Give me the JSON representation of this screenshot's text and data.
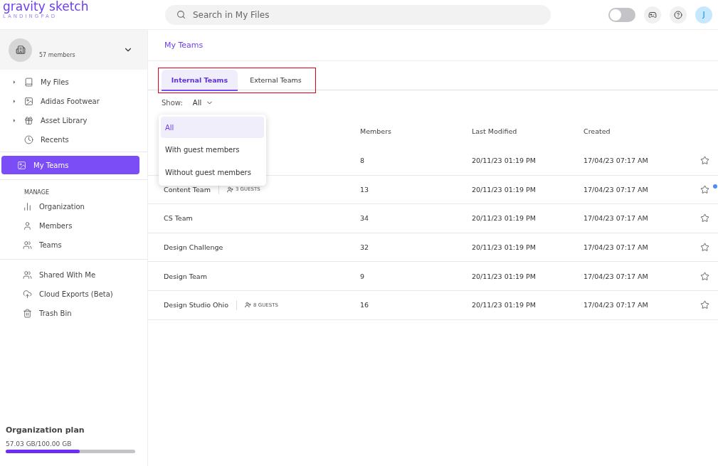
{
  "logo": {
    "name": "gravity sketch",
    "tagline": "LANDINGPAD"
  },
  "search": {
    "placeholder": "Search in My Files"
  },
  "header": {
    "toggle_on": false,
    "avatar": "J"
  },
  "org": {
    "members": "57 members"
  },
  "sidebar": {
    "items": [
      {
        "label": "My Files",
        "expandable": true,
        "selected": false
      },
      {
        "label": "Adidas Footwear",
        "expandable": true,
        "selected": false
      },
      {
        "label": "Asset Library",
        "expandable": true,
        "selected": false
      },
      {
        "label": "Recents",
        "expandable": false,
        "selected": false
      },
      {
        "label": "My Teams",
        "expandable": false,
        "selected": true
      }
    ],
    "manage_title": "MANAGE",
    "manage_items": [
      {
        "label": "Organization"
      },
      {
        "label": "Members"
      },
      {
        "label": "Teams"
      }
    ],
    "other_items": [
      {
        "label": "Shared With Me"
      },
      {
        "label": "Cloud Exports (Beta)"
      },
      {
        "label": "Trash Bin"
      }
    ]
  },
  "plan": {
    "title": "Organization plan",
    "usage": "57.03 GB/100.00 GB",
    "level": 0.57
  },
  "breadcrumb": "My Teams",
  "tabs": [
    {
      "label": "Internal Teams",
      "selected": true
    },
    {
      "label": "External Teams",
      "selected": false
    }
  ],
  "filter": {
    "label": "Show:",
    "value": "All"
  },
  "dropdown": {
    "options": [
      {
        "label": "All",
        "selected": true
      },
      {
        "label": "With guest members",
        "selected": false
      },
      {
        "label": "Without guest members",
        "selected": false
      }
    ]
  },
  "table": {
    "columns": [
      "Members",
      "Last Modified",
      "Created"
    ],
    "rows": [
      {
        "members": "8",
        "modified": "20/11/23 01:19 PM",
        "created": "17/04/23 07:17 AM"
      },
      {
        "name": "Content Team",
        "guests": "3 GUESTS",
        "members": "13",
        "modified": "20/11/23 01:19 PM",
        "created": "17/04/23 07:17 AM"
      },
      {
        "name": "CS Team",
        "members": "34",
        "modified": "20/11/23 01:19 PM",
        "created": "17/04/23 07:17 AM"
      },
      {
        "name": "Design Challenge",
        "members": "32",
        "modified": "20/11/23 01:19 PM",
        "created": "17/04/23 07:17 AM"
      },
      {
        "name": "Design Team",
        "members": "9",
        "modified": "20/11/23 01:19 PM",
        "created": "17/04/23 07:17 AM"
      },
      {
        "name": "Design Studio Ohio",
        "guests": "8 GUESTS",
        "members": "16",
        "modified": "20/11/23 01:19 PM",
        "created": "17/04/23 07:17 AM"
      }
    ]
  }
}
